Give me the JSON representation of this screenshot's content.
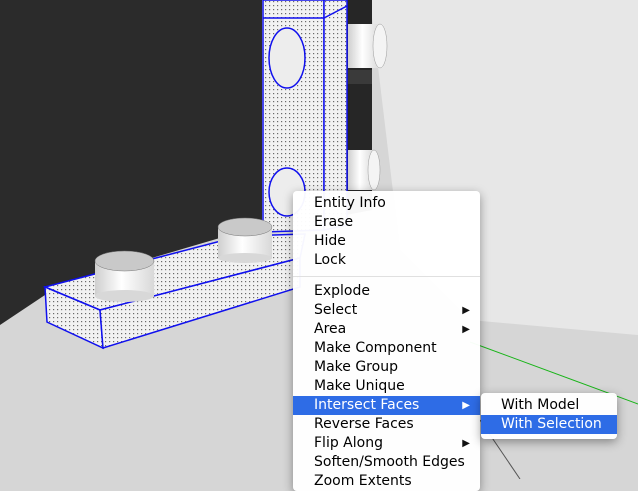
{
  "colors": {
    "highlight": "#2e6ce6",
    "selection_edge": "#1010ee",
    "ground": "#d6d6d6",
    "wall": "#2a2a2a",
    "axis_green": "#18b418"
  },
  "context_menu": {
    "items": [
      {
        "label": "Entity Info"
      },
      {
        "label": "Erase"
      },
      {
        "label": "Hide"
      },
      {
        "label": "Lock"
      },
      {
        "separator": true
      },
      {
        "label": "Explode"
      },
      {
        "label": "Select",
        "submenu": true
      },
      {
        "label": "Area",
        "submenu": true
      },
      {
        "label": "Make Component"
      },
      {
        "label": "Make Group"
      },
      {
        "label": "Make Unique"
      },
      {
        "label": "Intersect Faces",
        "submenu": true,
        "highlighted": true
      },
      {
        "label": "Reverse Faces"
      },
      {
        "label": "Flip Along",
        "submenu": true
      },
      {
        "label": "Soften/Smooth Edges"
      },
      {
        "label": "Zoom Extents"
      }
    ]
  },
  "submenu": {
    "items": [
      {
        "label": "With Model"
      },
      {
        "label": "With Selection",
        "highlighted": true
      }
    ]
  },
  "icons": {
    "submenu_arrow": "▶"
  }
}
